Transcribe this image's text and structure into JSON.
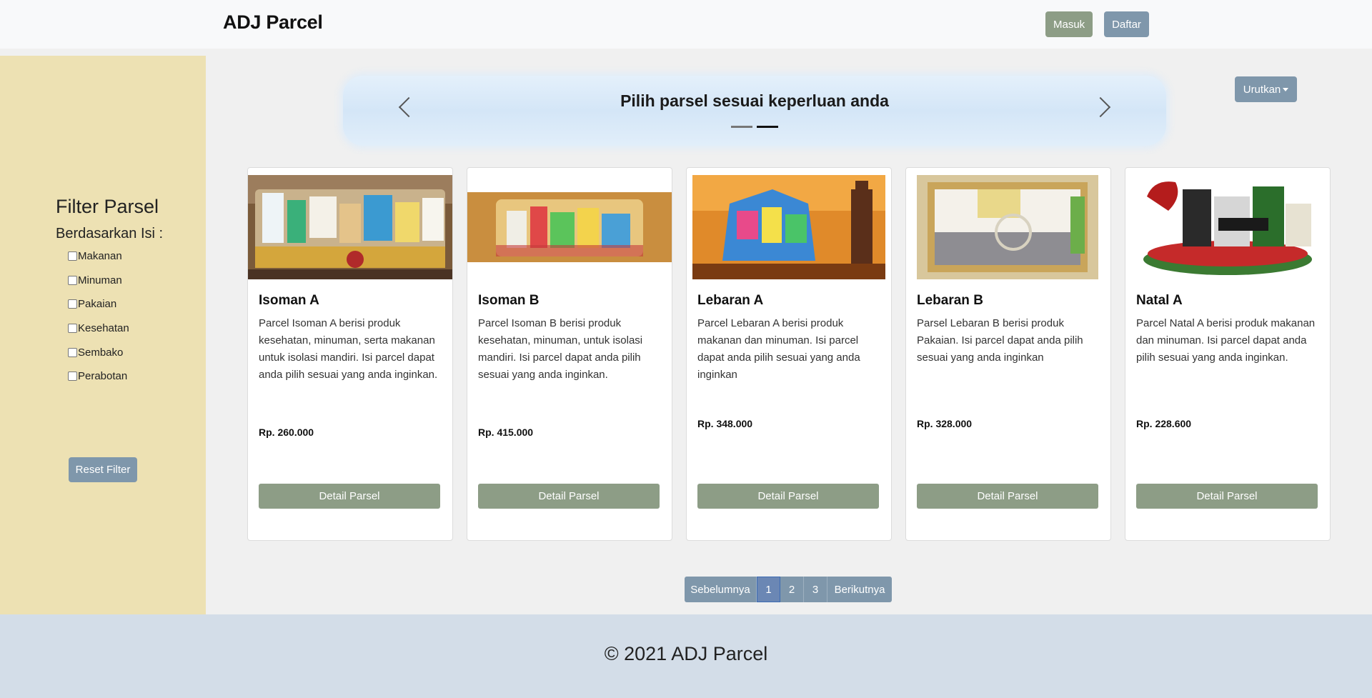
{
  "navbar": {
    "brand": "ADJ Parcel",
    "login_label": "Masuk",
    "register_label": "Daftar"
  },
  "sidebar": {
    "title": "Filter Parsel",
    "subtitle": "Berdasarkan Isi :",
    "filters": [
      {
        "label": "Makanan",
        "checked": false
      },
      {
        "label": "Minuman",
        "checked": false
      },
      {
        "label": "Pakaian",
        "checked": false
      },
      {
        "label": "Kesehatan",
        "checked": false
      },
      {
        "label": "Sembako",
        "checked": false
      },
      {
        "label": "Perabotan",
        "checked": false
      }
    ],
    "reset_label": "Reset Filter"
  },
  "carousel": {
    "text": "Pilih parsel sesuai keperluan anda",
    "slides": 2,
    "active_slide": 2
  },
  "sort": {
    "label": "Urutkan"
  },
  "products": [
    {
      "title": "Isoman A",
      "desc": "Parcel Isoman A berisi produk kesehatan, minuman, serta makanan untuk isolasi mandiri. Isi parcel dapat anda pilih sesuai yang anda inginkan.",
      "price": "Rp. 260.000",
      "button": "Detail Parsel"
    },
    {
      "title": "Isoman B",
      "desc": "Parcel Isoman B berisi produk kesehatan, minuman, untuk isolasi mandiri. Isi parcel dapat anda pilih sesuai yang anda inginkan.",
      "price": "Rp. 415.000",
      "button": "Detail Parsel"
    },
    {
      "title": "Lebaran A",
      "desc": "Parcel Lebaran A berisi produk makanan dan minuman. Isi parcel dapat anda pilih sesuai yang anda inginkan",
      "price": "Rp. 348.000",
      "button": "Detail Parsel"
    },
    {
      "title": "Lebaran B",
      "desc": "Parsel Lebaran B berisi produk Pakaian. Isi parcel dapat anda pilih sesuai yang anda inginkan",
      "price": "Rp. 328.000",
      "button": "Detail Parsel"
    },
    {
      "title": "Natal A",
      "desc": "Parcel Natal A berisi produk makanan dan minuman. Isi parcel dapat anda pilih sesuai yang anda inginkan.",
      "price": "Rp. 228.600",
      "button": "Detail Parsel"
    }
  ],
  "pagination": {
    "prev_label": "Sebelumnya",
    "pages": [
      "1",
      "2",
      "3"
    ],
    "current": "1",
    "next_label": "Berikutnya"
  },
  "footer": {
    "text": "© 2021 ADJ Parcel"
  },
  "colors": {
    "sidebar_bg": "#ede1b3",
    "primary_green": "#8d9d86",
    "primary_blue": "#7f97ab",
    "footer_bg": "#d3dde8"
  }
}
